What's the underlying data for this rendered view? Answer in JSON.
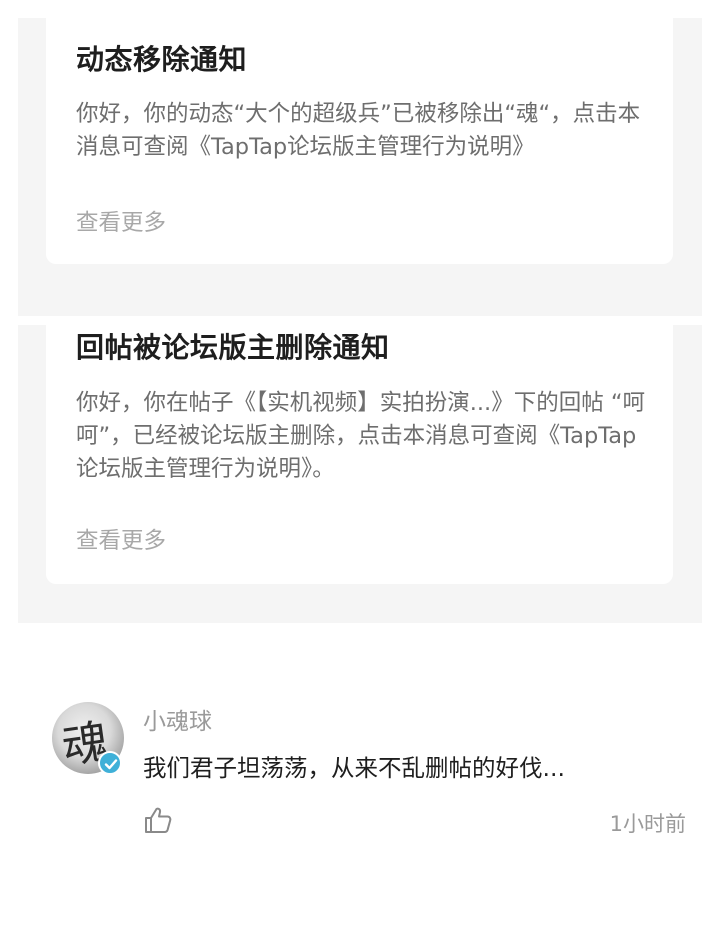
{
  "notifications": [
    {
      "title": "动态移除通知",
      "body": "你好，你的动态“大个的超级兵”已被移除出“魂“，点击本消息可查阅《TapTap论坛版主管理行为说明》",
      "more_label": "查看更多"
    },
    {
      "title": "回帖被论坛版主删除通知",
      "body": "你好，你在帖子《【实机视频】实拍扮演...》下的回帖 “呵呵”，已经被论坛版主删除，点击本消息可查阅《TapTap 论坛版主管理行为说明》。",
      "more_label": "查看更多"
    }
  ],
  "comment": {
    "username": "小魂球",
    "avatar_glyph": "魂",
    "text": "我们君子坦荡荡，从来不乱删帖的好伐...",
    "time": "1小时前",
    "badge_color": "#3fb0d8",
    "like_icon": "thumbs-up-icon"
  }
}
